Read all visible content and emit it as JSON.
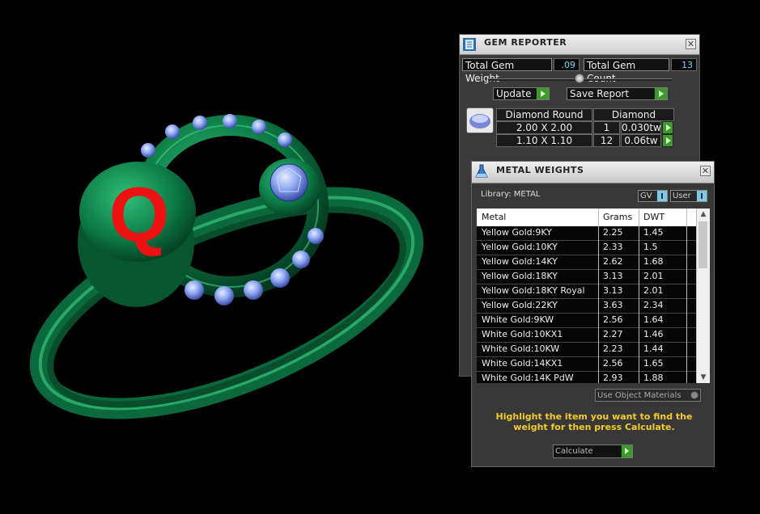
{
  "gem_reporter": {
    "title": "GEM REPORTER",
    "close": "✕",
    "total_gem_weight_label": "Total Gem Weight",
    "total_gem_weight_value": ".09",
    "total_gem_count_label": "Total Gem Count",
    "total_gem_count_value": "13",
    "update_label": "Update",
    "save_report_label": "Save Report",
    "gems": {
      "header": [
        "Diamond Round",
        "Diamond"
      ],
      "rows": [
        {
          "size": "2.00 X 2.00",
          "count": "1",
          "weight": "0.030tw"
        },
        {
          "size": "1.10 X 1.10",
          "count": "12",
          "weight": "0.06tw"
        }
      ]
    }
  },
  "metal_weights": {
    "title": "METAL WEIGHTS",
    "close": "✕",
    "library_label": "Library: METAL",
    "gv_label": "GV",
    "user_label": "User",
    "columns": [
      "Metal",
      "Grams",
      "DWT"
    ],
    "rows": [
      {
        "metal": "Yellow Gold:9KY",
        "grams": "2.25",
        "dwt": "1.45"
      },
      {
        "metal": "Yellow Gold:10KY",
        "grams": "2.33",
        "dwt": "1.5"
      },
      {
        "metal": "Yellow Gold:14KY",
        "grams": "2.62",
        "dwt": "1.68"
      },
      {
        "metal": "Yellow Gold:18KY",
        "grams": "3.13",
        "dwt": "2.01"
      },
      {
        "metal": "Yellow Gold:18KY Royal",
        "grams": "3.13",
        "dwt": "2.01"
      },
      {
        "metal": "Yellow Gold:22KY",
        "grams": "3.63",
        "dwt": "2.34"
      },
      {
        "metal": "White Gold:9KW",
        "grams": "2.56",
        "dwt": "1.64"
      },
      {
        "metal": "White Gold:10KX1",
        "grams": "2.27",
        "dwt": "1.46"
      },
      {
        "metal": "White Gold:10KW",
        "grams": "2.23",
        "dwt": "1.44"
      },
      {
        "metal": "White Gold:14KX1",
        "grams": "2.56",
        "dwt": "1.65"
      },
      {
        "metal": "White Gold:14K PdW",
        "grams": "2.93",
        "dwt": "1.88"
      }
    ],
    "use_object_materials_label": "Use Object Materials",
    "hint": "Highlight the item you want to find the weight for then press Calculate.",
    "calculate_label": "Calculate"
  },
  "ring": {
    "monogram": "Q",
    "colors": {
      "metal": "#0c7a45",
      "monogram": "#ee1111",
      "stones": "#8fa8f2"
    }
  }
}
